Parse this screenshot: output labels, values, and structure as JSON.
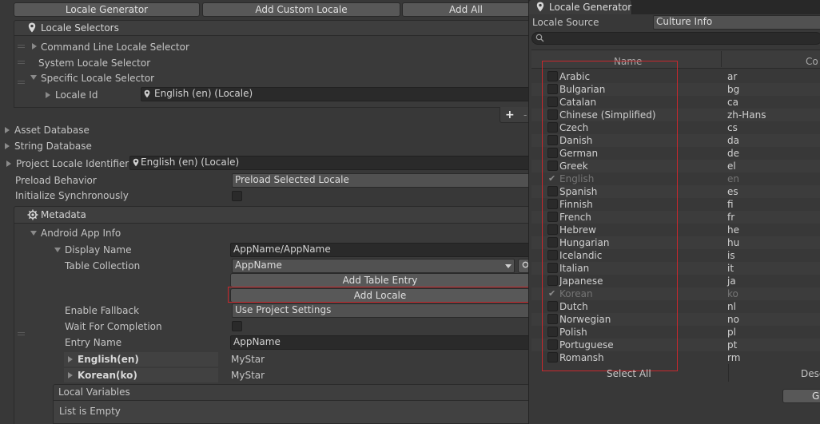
{
  "left": {
    "toolbar": [
      "Locale Generator",
      "Add Custom Locale",
      "Add All"
    ],
    "locale_selectors": {
      "title": "Locale Selectors",
      "items": [
        "Command Line Locale Selector",
        "System Locale Selector",
        "Specific Locale Selector"
      ],
      "locale_id_label": "Locale Id",
      "locale_id_value": "English (en) (Locale)",
      "add_glyph": "+",
      "remove_glyph": "-"
    },
    "asset_database": "Asset Database",
    "string_database": "String Database",
    "project_locale_identifier": {
      "label": "Project Locale Identifier",
      "value": "English (en) (Locale)"
    },
    "preload_behavior": {
      "label": "Preload Behavior",
      "value": "Preload Selected Locale"
    },
    "initialize_sync": {
      "label": "Initialize Synchronously"
    },
    "metadata": {
      "title": "Metadata",
      "android_app_info": "Android App Info",
      "display_name": {
        "label": "Display Name",
        "value": "AppName/AppName"
      },
      "table_collection": {
        "label": "Table Collection",
        "value": "AppName"
      },
      "add_table_entry": "Add Table Entry",
      "add_locale": "Add Locale",
      "enable_fallback": {
        "label": "Enable Fallback",
        "value": "Use Project Settings"
      },
      "wait_for_completion": {
        "label": "Wait For Completion"
      },
      "entry_name": {
        "label": "Entry Name",
        "value": "AppName"
      },
      "entries": [
        {
          "locale": "English(en)",
          "value": "MyStar"
        },
        {
          "locale": "Korean(ko)",
          "value": "MyStar"
        }
      ],
      "local_variables": "Local Variables",
      "list_empty": "List is Empty"
    }
  },
  "right": {
    "tab_title": "Locale Generator",
    "locale_source": {
      "label": "Locale Source",
      "value": "Culture Info"
    },
    "columns": {
      "name": "Name",
      "code": "Co"
    },
    "rows": [
      {
        "name": "Arabic",
        "code": "ar",
        "disabled": false
      },
      {
        "name": "Bulgarian",
        "code": "bg",
        "disabled": false
      },
      {
        "name": "Catalan",
        "code": "ca",
        "disabled": false
      },
      {
        "name": "Chinese (Simplified)",
        "code": "zh-Hans",
        "disabled": false
      },
      {
        "name": "Czech",
        "code": "cs",
        "disabled": false
      },
      {
        "name": "Danish",
        "code": "da",
        "disabled": false
      },
      {
        "name": "German",
        "code": "de",
        "disabled": false
      },
      {
        "name": "Greek",
        "code": "el",
        "disabled": false
      },
      {
        "name": "English",
        "code": "en",
        "disabled": true
      },
      {
        "name": "Spanish",
        "code": "es",
        "disabled": false
      },
      {
        "name": "Finnish",
        "code": "fi",
        "disabled": false
      },
      {
        "name": "French",
        "code": "fr",
        "disabled": false
      },
      {
        "name": "Hebrew",
        "code": "he",
        "disabled": false
      },
      {
        "name": "Hungarian",
        "code": "hu",
        "disabled": false
      },
      {
        "name": "Icelandic",
        "code": "is",
        "disabled": false
      },
      {
        "name": "Italian",
        "code": "it",
        "disabled": false
      },
      {
        "name": "Japanese",
        "code": "ja",
        "disabled": false
      },
      {
        "name": "Korean",
        "code": "ko",
        "disabled": true
      },
      {
        "name": "Dutch",
        "code": "nl",
        "disabled": false
      },
      {
        "name": "Norwegian",
        "code": "no",
        "disabled": false
      },
      {
        "name": "Polish",
        "code": "pl",
        "disabled": false
      },
      {
        "name": "Portuguese",
        "code": "pt",
        "disabled": false
      },
      {
        "name": "Romansh",
        "code": "rm",
        "disabled": false
      }
    ],
    "select_all": "Select All",
    "deselect": "Dese",
    "generate": "G"
  },
  "colors": {
    "highlight": "#c8282d",
    "panel": "#383838",
    "field": "#2a2a2a"
  }
}
